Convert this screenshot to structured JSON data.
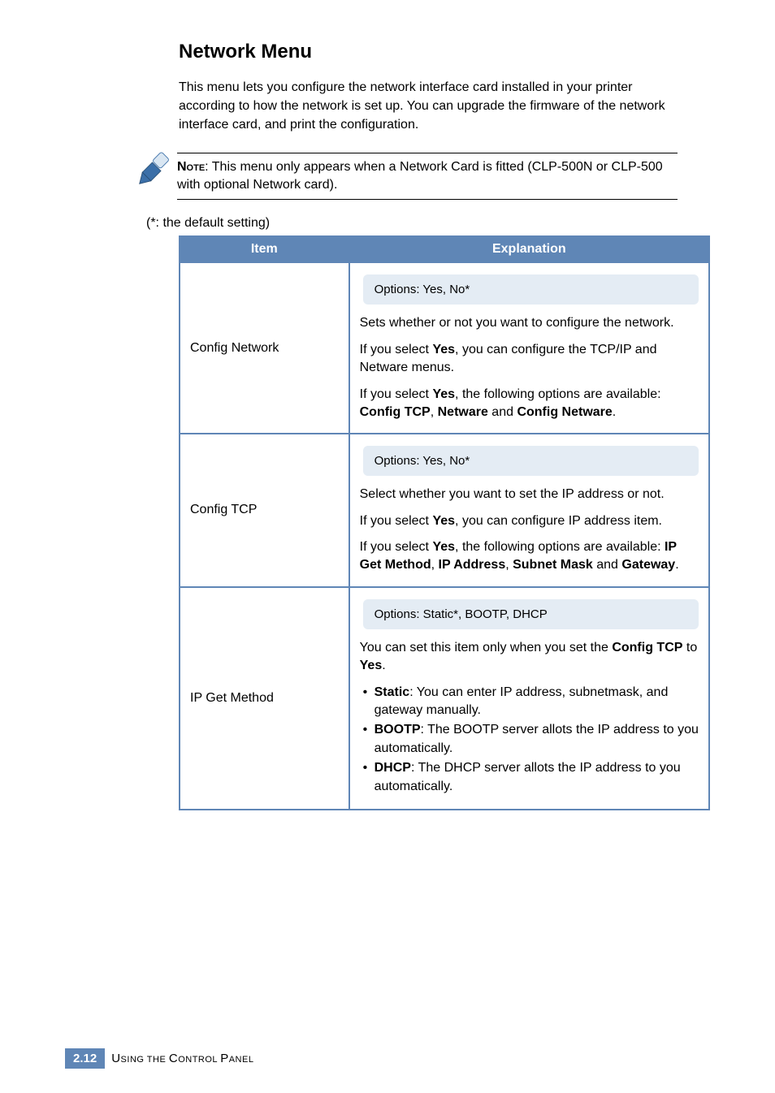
{
  "heading": "Network Menu",
  "intro": "This menu lets you configure the network interface card installed in your printer according to how the network is set up. You can upgrade the firmware of the network interface card, and print the configuration.",
  "note_label": "Note",
  "note_text": ": This menu only appears when a Network Card is fitted (CLP-500N or CLP-500 with optional Network card).",
  "default_setting": "(*: the default setting)",
  "table": {
    "headers": {
      "item": "Item",
      "explanation": "Explanation"
    },
    "rows": [
      {
        "item": "Config Network",
        "options": "Options: Yes, No*",
        "p1_a": "Sets whether or not you want to configure the network.",
        "p2_a": "If you select ",
        "p2_b": "Yes",
        "p2_c": ", you can configure the TCP/IP and Netware menus.",
        "p3_a": "If you select ",
        "p3_b": "Yes",
        "p3_c": ", the following options are available: ",
        "p3_d": "Config TCP",
        "p3_e": ", ",
        "p3_f": "Netware",
        "p3_g": " and ",
        "p3_h": "Config Netware",
        "p3_i": "."
      },
      {
        "item": "Config TCP",
        "options": "Options: Yes, No*",
        "p1_a": "Select whether you want to set the IP address or not.",
        "p2_a": "If you select ",
        "p2_b": "Yes",
        "p2_c": ", you can configure IP address item.",
        "p3_a": "If you select ",
        "p3_b": "Yes",
        "p3_c": ", the following options are available: ",
        "p3_d": "IP Get Method",
        "p3_e": ", ",
        "p3_f": "IP Address",
        "p3_g": ", ",
        "p3_h": "Subnet Mask",
        "p3_i": " and ",
        "p3_j": "Gateway",
        "p3_k": "."
      },
      {
        "item": "IP Get Method",
        "options": "Options: Static*, BOOTP, DHCP",
        "p1_a": "You can set this item only when you set the ",
        "p1_b": "Config TCP",
        "p1_c": " to ",
        "p1_d": "Yes",
        "p1_e": ".",
        "b1_a": "Static",
        "b1_b": ": You can enter IP address, subnetmask, and gateway manually.",
        "b2_a": "BOOTP",
        "b2_b": ": The BOOTP server allots the IP address to you automatically.",
        "b3_a": "DHCP",
        "b3_b": ": The DHCP server allots the IP address to you automatically."
      }
    ]
  },
  "footer": {
    "page_prefix": "2.",
    "page_number": "12",
    "text_a": "U",
    "text_b": "sing the ",
    "text_c": "C",
    "text_d": "ontrol ",
    "text_e": "P",
    "text_f": "anel"
  }
}
